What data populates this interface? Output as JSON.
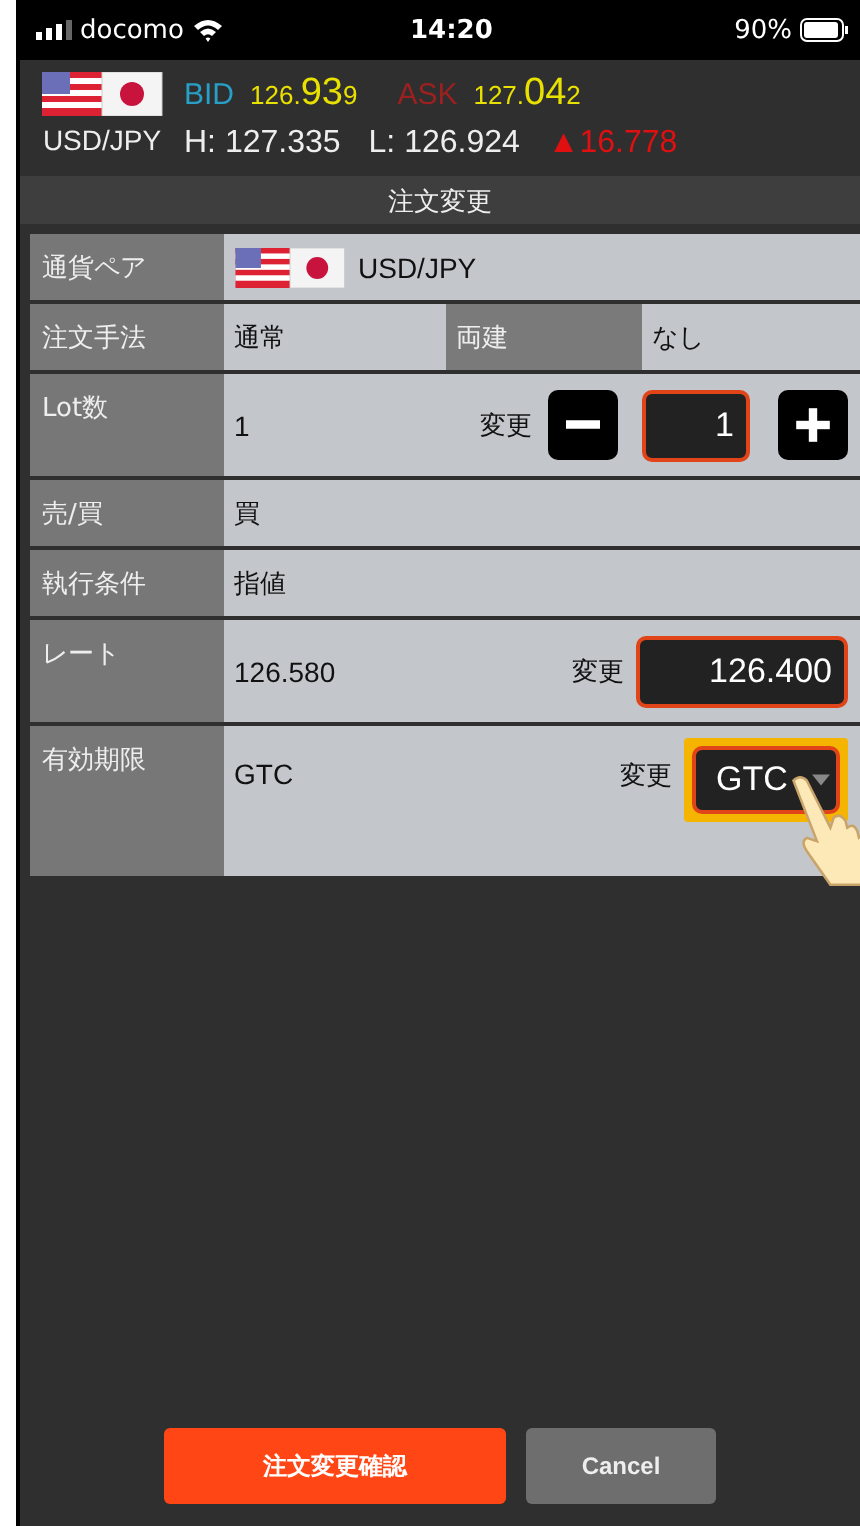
{
  "status_bar": {
    "carrier": "docomo",
    "time": "14:20",
    "battery": "90%"
  },
  "quote": {
    "pair": "USD/JPY",
    "bid_label": "BID",
    "bid": {
      "head": "126.",
      "big": "93",
      "pip": "9"
    },
    "ask_label": "ASK",
    "ask": {
      "head": "127.",
      "big": "04",
      "pip": "2"
    },
    "high": "H: 127.335",
    "low": "L: 126.924",
    "change": "▲16.778"
  },
  "title": "注文変更",
  "rows": [
    {
      "kind": "pair",
      "label": "通貨ペア",
      "value": "USD/JPY"
    },
    {
      "kind": "split",
      "label": "注文手法",
      "value": "通常",
      "label_2": "両建",
      "value_2": "なし"
    },
    {
      "kind": "stepper",
      "label": "Lot数",
      "value": "1",
      "change_label": "変更",
      "input": "1"
    },
    {
      "kind": "plain",
      "label": "売/買",
      "value": "買"
    },
    {
      "kind": "plain",
      "label": "執行条件",
      "value": "指値"
    },
    {
      "kind": "input",
      "label": "レート",
      "value": "126.580",
      "change_label": "変更",
      "input": "126.400"
    },
    {
      "kind": "select",
      "label": "有効期限",
      "value": "GTC",
      "change_label": "変更",
      "input": "GTC",
      "highlighted": true
    }
  ],
  "buttons": {
    "confirm": "注文変更確認",
    "cancel": "Cancel"
  }
}
